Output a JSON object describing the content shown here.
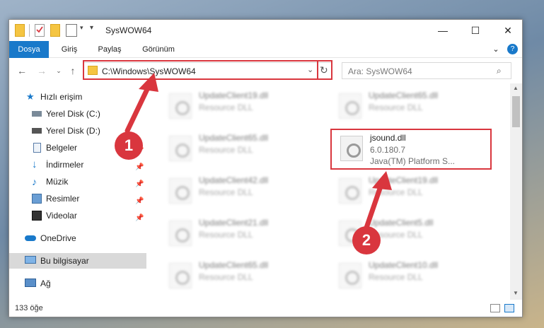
{
  "window": {
    "title": "SysWOW64"
  },
  "ribbon": {
    "tabs": [
      "Dosya",
      "Giriş",
      "Paylaş",
      "Görünüm"
    ]
  },
  "address": {
    "path": "C:\\Windows\\SysWOW64"
  },
  "search": {
    "placeholder": "Ara: SysWOW64"
  },
  "sidebar": {
    "items": [
      "Hızlı erişim",
      "Yerel Disk (C:)",
      "Yerel Disk (D:)",
      "Belgeler",
      "İndirmeler",
      "Müzik",
      "Resimler",
      "Videolar",
      "OneDrive",
      "Bu bilgisayar",
      "Ağ"
    ]
  },
  "files": {
    "left": [
      {
        "name": "UpdateClient19.dll",
        "type": "Resource DLL"
      },
      {
        "name": "UpdateClient65.dll",
        "type": "Resource DLL"
      },
      {
        "name": "UpdateClient42.dll",
        "type": "Resource DLL"
      },
      {
        "name": "UpdateClient21.dll",
        "type": "Resource DLL"
      },
      {
        "name": "UpdateClient65.dll",
        "type": "Resource DLL"
      }
    ],
    "right": [
      {
        "name": "UpdateClient65.dll",
        "type": "Resource DLL"
      },
      {
        "name": "UpdateClient19.dll",
        "type": "Resource DLL"
      },
      {
        "name": "UpdateClient5.dll",
        "type": "Resource DLL"
      },
      {
        "name": "UpdateClient10.dll",
        "type": "Resource DLL"
      }
    ],
    "highlight": {
      "name": "jsound.dll",
      "version": "6.0.180.7",
      "description": "Java(TM) Platform S..."
    }
  },
  "status": {
    "count": "133 öğe"
  },
  "annotations": {
    "one": "1",
    "two": "2"
  },
  "colors": {
    "accent": "#1979ca",
    "annotation": "#d9363e"
  }
}
